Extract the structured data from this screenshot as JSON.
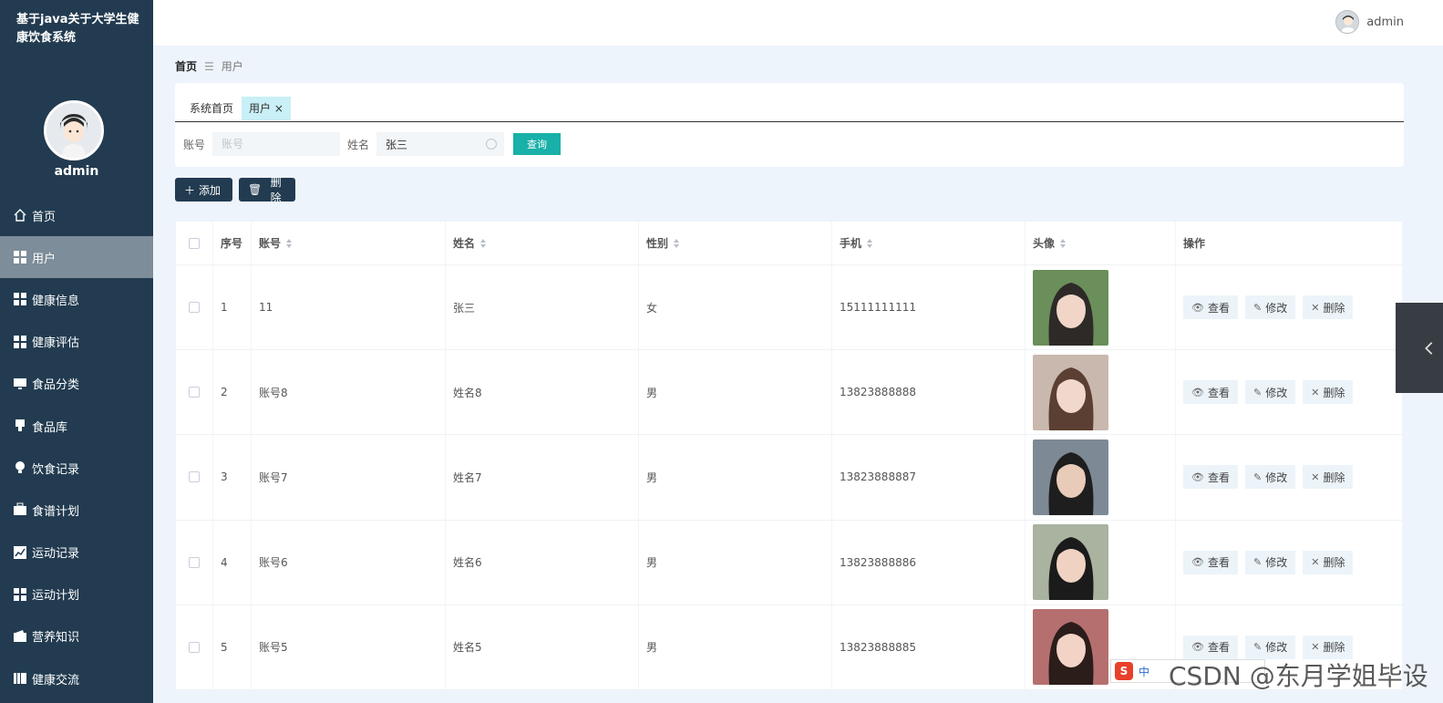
{
  "app": {
    "title": "基于java关于大学生健康饮食系统"
  },
  "sidebar": {
    "username": "admin",
    "items": [
      {
        "label": "首页",
        "icon": "home-icon"
      },
      {
        "label": "用户",
        "icon": "grid-icon",
        "active": true
      },
      {
        "label": "健康信息",
        "icon": "grid-icon"
      },
      {
        "label": "健康评估",
        "icon": "grid-icon"
      },
      {
        "label": "食品分类",
        "icon": "monitor-icon"
      },
      {
        "label": "食品库",
        "icon": "stamp-icon"
      },
      {
        "label": "饮食记录",
        "icon": "bulb-icon"
      },
      {
        "label": "食谱计划",
        "icon": "briefcase-icon"
      },
      {
        "label": "运动记录",
        "icon": "chart-icon"
      },
      {
        "label": "运动计划",
        "icon": "grid-icon"
      },
      {
        "label": "营养知识",
        "icon": "wallet-icon"
      },
      {
        "label": "健康交流",
        "icon": "book-icon"
      }
    ]
  },
  "topbar": {
    "username": "admin"
  },
  "breadcrumb": {
    "home": "首页",
    "current": "用户"
  },
  "tabs": [
    {
      "label": "系统首页"
    },
    {
      "label": "用户"
    }
  ],
  "search": {
    "account_label": "账号",
    "account_placeholder": "账号",
    "name_label": "姓名",
    "name_value": "张三",
    "query_button": "查询"
  },
  "actions": {
    "add": "添加",
    "delete": "删除"
  },
  "table": {
    "headers": {
      "index": "序号",
      "account": "账号",
      "name": "姓名",
      "gender": "性别",
      "phone": "手机",
      "avatar": "头像",
      "ops": "操作"
    },
    "ops": {
      "view": "查看",
      "edit": "修改",
      "delete": "删除"
    },
    "rows": [
      {
        "index": "1",
        "account": "11",
        "name": "张三",
        "gender": "女",
        "phone": "15111111111"
      },
      {
        "index": "2",
        "account": "账号8",
        "name": "姓名8",
        "gender": "男",
        "phone": "13823888888"
      },
      {
        "index": "3",
        "account": "账号7",
        "name": "姓名7",
        "gender": "男",
        "phone": "13823888887"
      },
      {
        "index": "4",
        "account": "账号6",
        "name": "姓名6",
        "gender": "男",
        "phone": "13823888886"
      },
      {
        "index": "5",
        "account": "账号5",
        "name": "姓名5",
        "gender": "男",
        "phone": "13823888885"
      }
    ]
  },
  "overlay": {
    "ime_text": "中",
    "watermark": "CSDN @东月学姐毕设"
  },
  "colors": {
    "sidebar": "#223b50",
    "accent": "#18b0a8",
    "active_menu": "#7d8d99"
  }
}
